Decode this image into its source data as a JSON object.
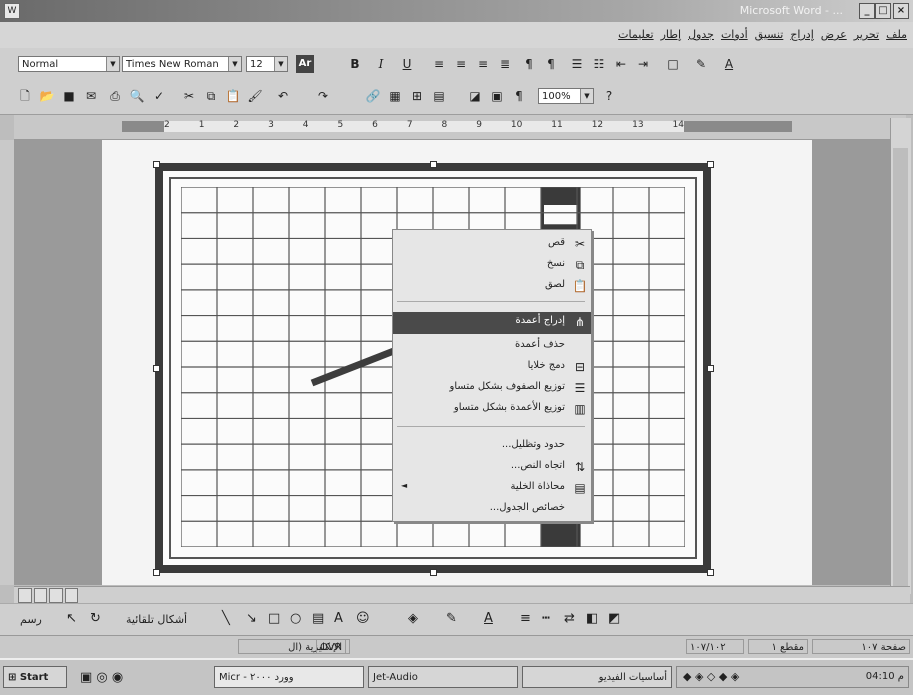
{
  "window": {
    "title": "Microsoft Word - ...",
    "system_icon": "word-doc-icon",
    "controls": [
      "_",
      "□",
      "×"
    ]
  },
  "menu": {
    "items": [
      "ملف",
      "تحرير",
      "عرض",
      "إدراج",
      "تنسيق",
      "أدوات",
      "جدول",
      "إطار",
      "تعليمات"
    ]
  },
  "format_toolbar": {
    "style": "Normal",
    "font": "Times New Roman",
    "size": "12",
    "buttons": [
      "Ar",
      "B",
      "I",
      "U"
    ]
  },
  "standard_toolbar": {
    "zoom": "100%"
  },
  "ruler": {
    "numbers": [
      "2",
      "1",
      "2",
      "3",
      "4",
      "5",
      "6",
      "7",
      "8",
      "9",
      "10",
      "11",
      "12",
      "13",
      "14"
    ]
  },
  "table": {
    "columns": 14,
    "rows": 14
  },
  "context_menu": {
    "items": [
      {
        "label": "قص",
        "icon": "scissors-icon"
      },
      {
        "label": "نسخ",
        "icon": "copy-icon"
      },
      {
        "label": "لصق",
        "icon": "paste-icon"
      },
      {
        "label": "إدراج أعمدة",
        "icon": "insert-columns-icon",
        "highlighted": true
      },
      {
        "label": "حذف أعمدة",
        "icon": ""
      },
      {
        "label": "دمج خلايا",
        "icon": "merge-cells-icon"
      },
      {
        "label": "توزيع الصفوف بشكل متساو",
        "icon": "distribute-rows-icon"
      },
      {
        "label": "توزيع الأعمدة بشكل متساو",
        "icon": "distribute-columns-icon"
      },
      {
        "label": "حدود وتظليل...",
        "icon": ""
      },
      {
        "label": "اتجاه النص...",
        "icon": "text-direction-icon"
      },
      {
        "label": "محاذاة الخلية",
        "icon": "cell-alignment-icon"
      },
      {
        "label": "خصائص الجدول...",
        "icon": ""
      }
    ]
  },
  "drawing_toolbar": {
    "draw": "رسم",
    "autoshapes": "أشكال تلقائية"
  },
  "status_bar": {
    "page": "صفحة ١٠٧",
    "section": "مقطع ١",
    "pages": "١٠٧/١٠٢",
    "ovr": "OVR",
    "lang": "الإنكليزية (ال"
  },
  "taskbar": {
    "start": "Start",
    "tasks": [
      "Micr - وورد ٢٠٠٠",
      "Jet-Audio",
      "أساسيات الفيديو"
    ],
    "clock": "04:10 م"
  },
  "colors": {
    "highlight": "#4a4a4a",
    "menu_bg": "#e6e6e6",
    "page_bg": "#f4f4f4",
    "frame": "#3a3a3a"
  }
}
